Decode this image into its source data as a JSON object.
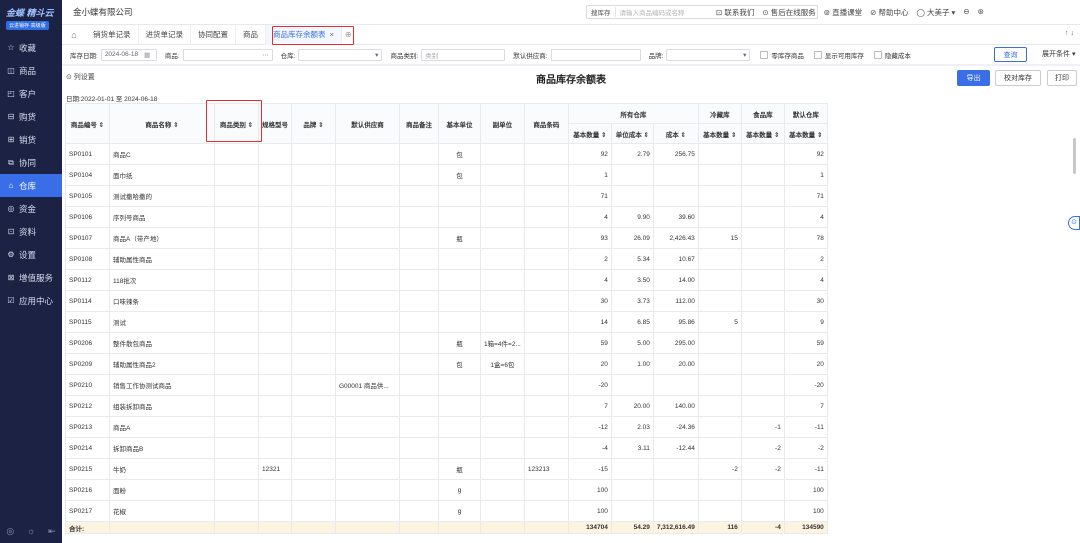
{
  "brand": {
    "name": "金蝶 精斗云",
    "sub": "云进销存·高级版"
  },
  "sidebar": {
    "items": [
      {
        "icon": "star-icon",
        "glyph": "☆",
        "label": "收藏"
      },
      {
        "icon": "box-icon",
        "glyph": "◫",
        "label": "商品"
      },
      {
        "icon": "customer-icon",
        "glyph": "◰",
        "label": "客户"
      },
      {
        "icon": "purchase-icon",
        "glyph": "⊟",
        "label": "购货"
      },
      {
        "icon": "sales-icon",
        "glyph": "⊞",
        "label": "销货"
      },
      {
        "icon": "cooperate-icon",
        "glyph": "⧉",
        "label": "协同"
      },
      {
        "icon": "warehouse-icon",
        "glyph": "⌂",
        "label": "仓库"
      },
      {
        "icon": "money-icon",
        "glyph": "◎",
        "label": "资金"
      },
      {
        "icon": "data-icon",
        "glyph": "⊡",
        "label": "资料"
      },
      {
        "icon": "settings-icon",
        "glyph": "⚙",
        "label": "设置"
      },
      {
        "icon": "service-icon",
        "glyph": "⊠",
        "label": "增值服务"
      },
      {
        "icon": "app-icon",
        "glyph": "☑",
        "label": "应用中心"
      }
    ],
    "active_index": 6,
    "footer": [
      "◎",
      "☼",
      "⇤"
    ]
  },
  "topbar": {
    "company": "金小蝶有限公司",
    "search_scope": "搜库存",
    "search_placeholder": "请输入商品编码或名称",
    "links": [
      "⊡ 联系我们",
      "⊙ 售后在线服务",
      "⊚ 直播课堂",
      "⊘ 帮助中心",
      "◯ 大美子 ▾",
      "⊖",
      "⊛"
    ]
  },
  "tabs": {
    "items": [
      "销货单记录",
      "进货单记录",
      "协同配置",
      "商品",
      "商品库存余额表"
    ],
    "active_index": 4,
    "close": "×",
    "add": "⊕",
    "right": "↑ ↓"
  },
  "filters": {
    "date_label": "库存日期:",
    "date_value": "2024-06-18",
    "goods_label": "商品:",
    "warehouse_label": "仓库:",
    "category_label": "商品类别:",
    "category_placeholder": "类别",
    "supplier_label": "默认供应商:",
    "brand_label": "品牌:",
    "checkboxes": [
      "零库存商品",
      "显示可用库存",
      "隐藏成本"
    ],
    "query": "查询",
    "expand": "展开条件 ▾"
  },
  "report": {
    "settings": "⊙ 列设置",
    "title": "商品库存余额表",
    "date_range": "日期:2022-01-01 至 2024-06-18",
    "export": "导出",
    "calibrate": "校对库存",
    "print": "打印"
  },
  "table": {
    "base_headers": [
      "商品编号 ⇕",
      "商品名称 ⇕",
      "商品类别 ⇕",
      "规格型号",
      "品牌 ⇕",
      "默认供应商",
      "商品备注",
      "基本单位",
      "副单位",
      "商品条码"
    ],
    "groups": [
      "所有仓库",
      "冷藏库",
      "食品库",
      "默认仓库"
    ],
    "sub_headers": [
      "基本数量 ⇕",
      "单位成本 ⇕",
      "成本 ⇕",
      "基本数量 ⇕",
      "基本数量 ⇕",
      "基本数量 ⇕"
    ],
    "rows": [
      [
        "SP0101",
        "商品C",
        "",
        "",
        "",
        "",
        "",
        "包",
        "",
        "",
        "92",
        "2.79",
        "256.75",
        "",
        "",
        "92"
      ],
      [
        "SP0104",
        "面巾纸",
        "",
        "",
        "",
        "",
        "",
        "包",
        "",
        "",
        "1",
        "",
        "",
        "",
        "",
        "1"
      ],
      [
        "SP0105",
        "测试撒哈撒的",
        "",
        "",
        "",
        "",
        "",
        "",
        "",
        "",
        "71",
        "",
        "",
        "",
        "",
        "71"
      ],
      [
        "SP0106",
        "序列号商品",
        "",
        "",
        "",
        "",
        "",
        "",
        "",
        "",
        "4",
        "9.90",
        "39.60",
        "",
        "",
        "4"
      ],
      [
        "SP0107",
        "商品A（带产地）",
        "",
        "",
        "",
        "",
        "",
        "瓶",
        "",
        "",
        "93",
        "26.09",
        "2,426.43",
        "15",
        "",
        "78"
      ],
      [
        "SP0108",
        "辅助属性商品",
        "",
        "",
        "",
        "",
        "",
        "",
        "",
        "",
        "2",
        "5.34",
        "10.67",
        "",
        "",
        "2"
      ],
      [
        "SP0112",
        "118批次",
        "",
        "",
        "",
        "",
        "",
        "",
        "",
        "",
        "4",
        "3.50",
        "14.00",
        "",
        "",
        "4"
      ],
      [
        "SP0114",
        "口味辣条",
        "",
        "",
        "",
        "",
        "",
        "",
        "",
        "",
        "30",
        "3.73",
        "112.00",
        "",
        "",
        "30"
      ],
      [
        "SP0115",
        "测试",
        "",
        "",
        "",
        "",
        "",
        "",
        "",
        "",
        "14",
        "6.85",
        "95.86",
        "5",
        "",
        "9"
      ],
      [
        "SP0206",
        "整件散包商品",
        "",
        "",
        "",
        "",
        "",
        "瓶",
        "1箱=4件=2...",
        "",
        "59",
        "5.00",
        "295.00",
        "",
        "",
        "59"
      ],
      [
        "SP0209",
        "辅助属性商品2",
        "",
        "",
        "",
        "",
        "",
        "包",
        "1盒=6包",
        "",
        "20",
        "1.00",
        "20.00",
        "",
        "",
        "20"
      ],
      [
        "SP0210",
        "销售工作协测试商品",
        "",
        "",
        "",
        "G00001 商品供...",
        "",
        "",
        "",
        "",
        "-20",
        "",
        "",
        "",
        "",
        "-20"
      ],
      [
        "SP0212",
        "组装拆卸商品",
        "",
        "",
        "",
        "",
        "",
        "",
        "",
        "",
        "7",
        "20.00",
        "140.00",
        "",
        "",
        "7"
      ],
      [
        "SP0213",
        "商品A",
        "",
        "",
        "",
        "",
        "",
        "",
        "",
        "",
        "-12",
        "2.03",
        "-24.36",
        "",
        "-1",
        "-11"
      ],
      [
        "SP0214",
        "拆卸商品B",
        "",
        "",
        "",
        "",
        "",
        "",
        "",
        "",
        "-4",
        "3.11",
        "-12.44",
        "",
        "-2",
        "-2"
      ],
      [
        "SP0215",
        "牛奶",
        "",
        "12321",
        "",
        "",
        "",
        "瓶",
        "",
        "123213",
        "-15",
        "",
        "",
        "-2",
        "-2",
        "-11"
      ],
      [
        "SP0216",
        "面粉",
        "",
        "",
        "",
        "",
        "",
        "g",
        "",
        "",
        "100",
        "",
        "",
        "",
        "",
        "100"
      ],
      [
        "SP0217",
        "花椒",
        "",
        "",
        "",
        "",
        "",
        "g",
        "",
        "",
        "100",
        "",
        "",
        "",
        "",
        "100"
      ]
    ],
    "total": [
      "合计:",
      "",
      "",
      "",
      "",
      "",
      "",
      "",
      "",
      "",
      "134704",
      "54.29",
      "7,312,616.49",
      "116",
      "-4",
      "134590"
    ]
  }
}
